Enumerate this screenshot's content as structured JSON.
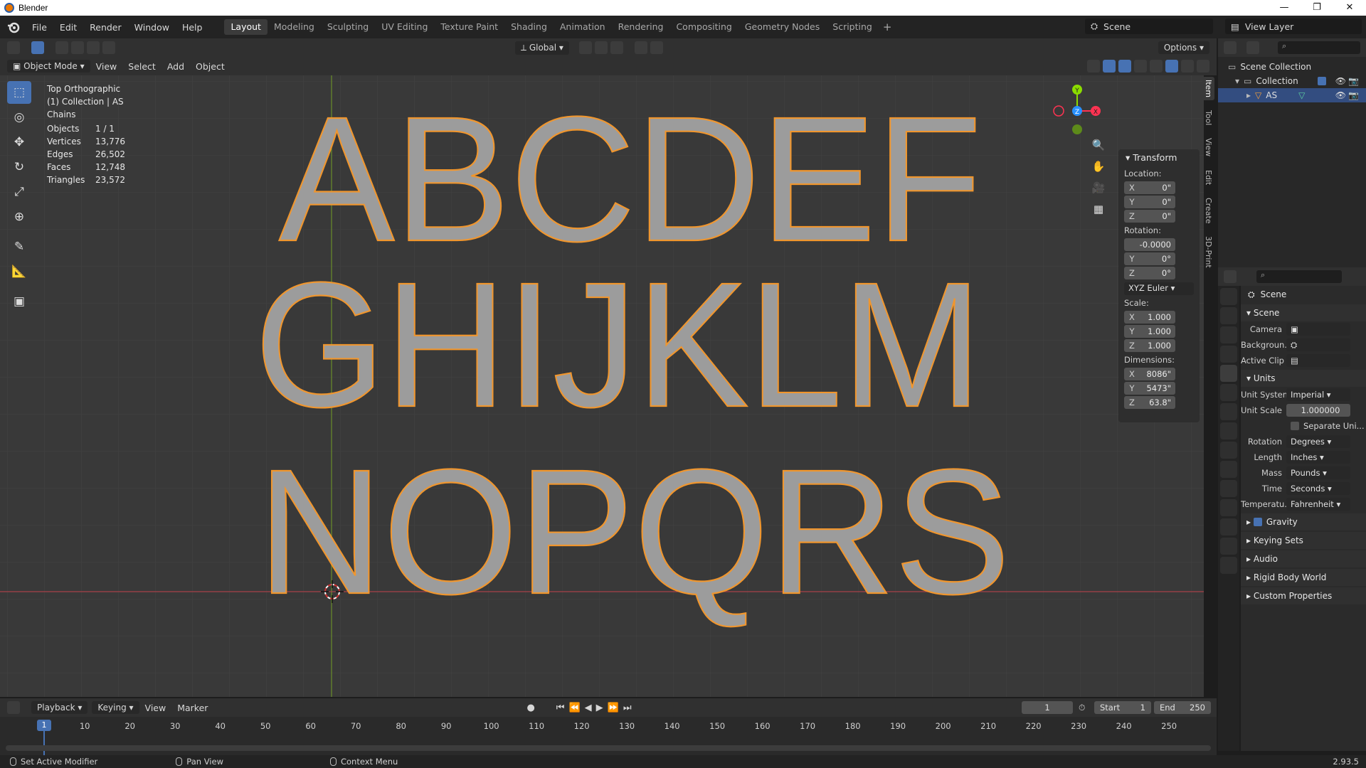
{
  "window": {
    "title": "Blender",
    "controls": [
      "—",
      "❐",
      "✕"
    ]
  },
  "menu": [
    "File",
    "Edit",
    "Render",
    "Window",
    "Help"
  ],
  "workspaces": [
    "Layout",
    "Modeling",
    "Sculpting",
    "UV Editing",
    "Texture Paint",
    "Shading",
    "Animation",
    "Rendering",
    "Compositing",
    "Geometry Nodes",
    "Scripting"
  ],
  "active_workspace": "Layout",
  "scene_name": "Scene",
  "view_layer": "View Layer",
  "transform_orientation": "Global",
  "options_label": "Options",
  "mode": "Object Mode",
  "viewport_menus": [
    "View",
    "Select",
    "Add",
    "Object"
  ],
  "overlay": {
    "view_name": "Top Orthographic",
    "collection_line": "(1) Collection | AS",
    "units_line": "Chains"
  },
  "stats": [
    {
      "k": "Objects",
      "v": "1 / 1"
    },
    {
      "k": "Vertices",
      "v": "13,776"
    },
    {
      "k": "Edges",
      "v": "26,502"
    },
    {
      "k": "Faces",
      "v": "12,748"
    },
    {
      "k": "Triangles",
      "v": "23,572"
    }
  ],
  "letters": {
    "row1": "ABCDEF",
    "row2": "GHIJKLM",
    "row3": "NOPQRS"
  },
  "npanel": {
    "title": "Transform",
    "location_label": "Location:",
    "location": [
      {
        "ax": "X",
        "v": "0\""
      },
      {
        "ax": "Y",
        "v": "0\""
      },
      {
        "ax": "Z",
        "v": "0\""
      }
    ],
    "rotation_label": "Rotation:",
    "rotation": [
      {
        "ax": "",
        "v": "-0.0000"
      },
      {
        "ax": "Y",
        "v": "0°"
      },
      {
        "ax": "Z",
        "v": "0°"
      }
    ],
    "rotation_mode": "XYZ Euler",
    "scale_label": "Scale:",
    "scale": [
      {
        "ax": "X",
        "v": "1.000"
      },
      {
        "ax": "Y",
        "v": "1.000"
      },
      {
        "ax": "Z",
        "v": "1.000"
      }
    ],
    "dimensions_label": "Dimensions:",
    "dimensions": [
      {
        "ax": "X",
        "v": "8086\""
      },
      {
        "ax": "Y",
        "v": "5473\""
      },
      {
        "ax": "Z",
        "v": "63.8\""
      }
    ],
    "side_tabs": [
      "Item",
      "Tool",
      "View",
      "Edit",
      "Create",
      "3D-Print"
    ]
  },
  "outliner": {
    "rows": [
      {
        "label": "Scene Collection"
      },
      {
        "label": "Collection"
      },
      {
        "label": "AS"
      }
    ]
  },
  "properties": {
    "header": "Scene",
    "scene_section": "Scene",
    "camera_label": "Camera",
    "background_label": "Backgroun...",
    "active_clip_label": "Active Clip",
    "units_section": "Units",
    "unit_system_label": "Unit System",
    "unit_system": "Imperial",
    "unit_scale_label": "Unit Scale",
    "unit_scale": "1.000000",
    "separate_units": "Separate Uni...",
    "rotation_label": "Rotation",
    "rotation": "Degrees",
    "length_label": "Length",
    "length": "Inches",
    "mass_label": "Mass",
    "mass": "Pounds",
    "time_label": "Time",
    "time": "Seconds",
    "temperature_label": "Temperatu...",
    "temperature": "Fahrenheit",
    "gravity": "Gravity",
    "keying_sets": "Keying Sets",
    "audio": "Audio",
    "rigid_body_world": "Rigid Body World",
    "custom_properties": "Custom Properties"
  },
  "timeline": {
    "menus": [
      "Playback",
      "Keying",
      "View",
      "Marker"
    ],
    "current_frame": "1",
    "start_label": "Start",
    "start": "1",
    "end_label": "End",
    "end": "250",
    "ruler": [
      "10",
      "20",
      "30",
      "40",
      "50",
      "60",
      "70",
      "80",
      "90",
      "100",
      "110",
      "120",
      "130",
      "140",
      "150",
      "160",
      "170",
      "180",
      "190",
      "200",
      "210",
      "220",
      "230",
      "240",
      "250"
    ],
    "playhead": "1"
  },
  "status": {
    "left": "Set Active Modifier",
    "middle": "Pan View",
    "right": "Context Menu",
    "version": "2.93.5"
  },
  "colors": {
    "accent": "#4772b3",
    "selection_outline": "#f5a03c",
    "x_axis": "#ff3352",
    "y_axis": "#8bdc00",
    "z_axis": "#2890ff"
  }
}
